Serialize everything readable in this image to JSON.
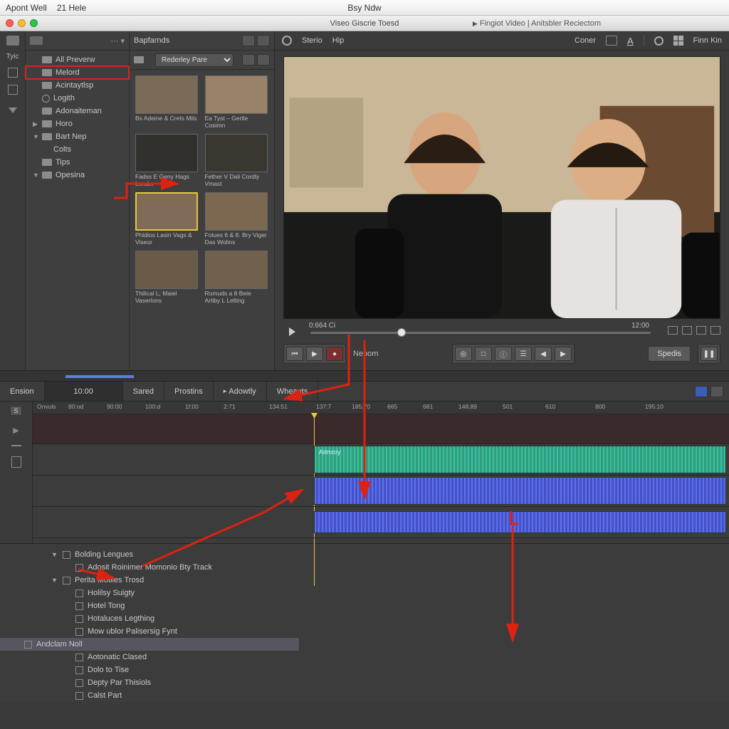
{
  "os_menu": {
    "left1": "Apont Well",
    "left2": "21 Hele",
    "center": "Bsy Ndw"
  },
  "window": {
    "title": "Viseo Giscrie Toesd",
    "subtitle": "Fingiot Video | Anitsbler Reciectom"
  },
  "rail_label": "Tyic",
  "tree": {
    "items": [
      {
        "label": "All Preverw",
        "caret": "",
        "icon": "folder"
      },
      {
        "label": "Melord",
        "caret": "",
        "icon": "folder",
        "selected": true
      },
      {
        "label": "Acintaytlsp",
        "caret": "",
        "icon": "folder"
      },
      {
        "label": "Logith",
        "caret": "",
        "icon": "clock"
      },
      {
        "label": "Adonaiteman",
        "caret": "",
        "icon": "folder"
      },
      {
        "label": "Horo",
        "caret": "▶",
        "icon": "folder"
      },
      {
        "label": "Bart Nep",
        "caret": "▼",
        "icon": "folder"
      },
      {
        "label": "Colts",
        "caret": "",
        "icon": "",
        "indent": true
      },
      {
        "label": "Tips",
        "caret": "",
        "icon": "folder"
      },
      {
        "label": "Opesina",
        "caret": "▼",
        "icon": "folder"
      }
    ]
  },
  "bin": {
    "title": "Bapfarnds",
    "dropdown": "Rederley Pare",
    "clips": [
      {
        "cap": "Bs Adeine & Crets Mils"
      },
      {
        "cap": "Ea Tyst – Gertle Cosimn"
      },
      {
        "cap": "Fadss E Geny Hags Londer"
      },
      {
        "cap": "Fether V Dali Cordly Vmast"
      },
      {
        "cap": "Phidios Lasin Vags & Viseor",
        "selected": true
      },
      {
        "cap": "Folues 6 & 8. Bry Viger Das Wolins"
      },
      {
        "cap": "Thilical L; Maiel Vaserlons"
      },
      {
        "cap": "Romuds a 8 Bele Artiby L Lelting"
      }
    ]
  },
  "viewer": {
    "btns": {
      "sterio": "Sterio",
      "hip": "Hip",
      "coner": "Coner",
      "finn": "Finn Kin"
    },
    "tc_left": "0:664 Ci",
    "tc_right": "12:00",
    "nepom": "Nepom",
    "speak": "Spedis"
  },
  "timeline": {
    "tabs": {
      "ension": "Ension",
      "tc": "10:00",
      "sared": "Sared",
      "prostins": "Prostins",
      "adowtly": "Adowtly",
      "wheants": "Wheants"
    },
    "left_badge": "S",
    "ruler": [
      "Onvuls",
      "80:od",
      "90:00",
      "100:d",
      "1f:00",
      "2:71",
      "134:51",
      "137:7",
      "185:70",
      "665",
      "681",
      "148,89",
      "501",
      "610",
      "800",
      "195:10"
    ],
    "track_label": "Aitmroy"
  },
  "fx": {
    "items": [
      {
        "label": "Bolding Lengues",
        "group": true
      },
      {
        "label": "Adosit Roinimer Momonio Bty Track",
        "indent": 1
      },
      {
        "label": "Perita Motlies Trosd",
        "group": true
      },
      {
        "label": "Holilsy Suigty",
        "indent": 1
      },
      {
        "label": "Hotel Tong",
        "indent": 1
      },
      {
        "label": "Hotaluces Legthing",
        "indent": 1
      },
      {
        "label": "Mow ublor Palisersig Fynt",
        "indent": 1
      },
      {
        "label": "Andclam Noll",
        "indent": 1,
        "selected": true
      },
      {
        "label": "Aotonatic Clased",
        "indent": 1
      },
      {
        "label": "Dolo to Tise",
        "indent": 1
      },
      {
        "label": "Depty Par Thisiols",
        "indent": 1
      },
      {
        "label": "Calst Part",
        "indent": 1
      }
    ]
  }
}
